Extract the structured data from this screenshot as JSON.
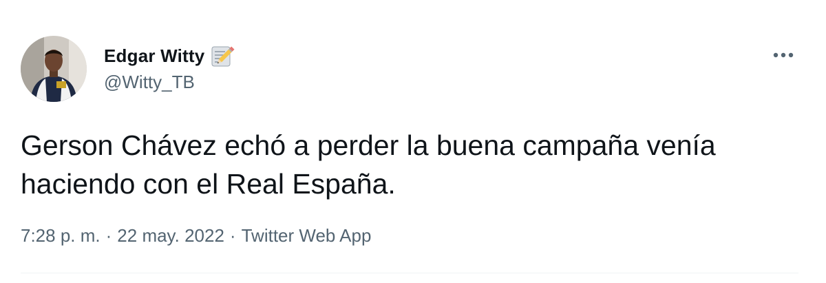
{
  "user": {
    "display_name": "Edgar Witty",
    "handle": "@Witty_TB",
    "badge_icon": "memo-icon"
  },
  "tweet": {
    "text": "Gerson Chávez echó a perder la buena campaña venía haciendo con el Real España.",
    "time": "7:28 p. m.",
    "date": "22 may. 2022",
    "separator": "·",
    "source": "Twitter Web App"
  },
  "icons": {
    "more": "more-horizontal-icon"
  },
  "colors": {
    "primary_text": "#0f1419",
    "secondary_text": "#536471",
    "divider": "#eff3f4"
  }
}
